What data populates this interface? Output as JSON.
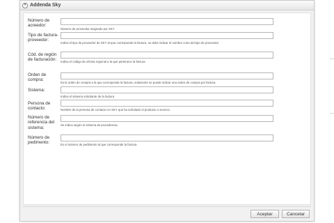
{
  "dialog": {
    "title": "Addenda Sky",
    "icon": "circle-icon"
  },
  "fields": [
    {
      "label": "Número de acreedor:",
      "value": "",
      "hint": "Número de proveedor asignado por SKY"
    },
    {
      "label": "Tipo de factura-proveedor:",
      "value": "",
      "hint": "Indica el tipo de proveedor de SKY al que corresponde la factura, se debe indicar el nombre corto del tipo de proveedor"
    },
    {
      "label": "Cód. de región de facturación:",
      "value": "",
      "hint": "Indica el código de oficina regional a la que pertenece la factura"
    },
    {
      "label": "Orden de compra:",
      "value": "",
      "hint": "Es la orden de compra a la que corresponde la factura, solamente se puede indicar una orden de compra por factura."
    },
    {
      "label": "Sistema:",
      "value": "",
      "hint": "Indica el sistema solicitante de la factura"
    },
    {
      "label": "Persona de contacto:",
      "value": "",
      "hint": "Nombre de la persona de contacto en SKY que ha solicitado el producto o servicio"
    },
    {
      "label": "Número de referencia del sistema:",
      "value": "",
      "hint": "Se indica según el sistema de procedencia"
    },
    {
      "label": "Número de pedimento:",
      "value": "",
      "hint": "Es el número de pedimento al que corresponde la factura"
    }
  ],
  "buttons": {
    "accept": "Aceptar",
    "cancel": "Cancelar"
  }
}
